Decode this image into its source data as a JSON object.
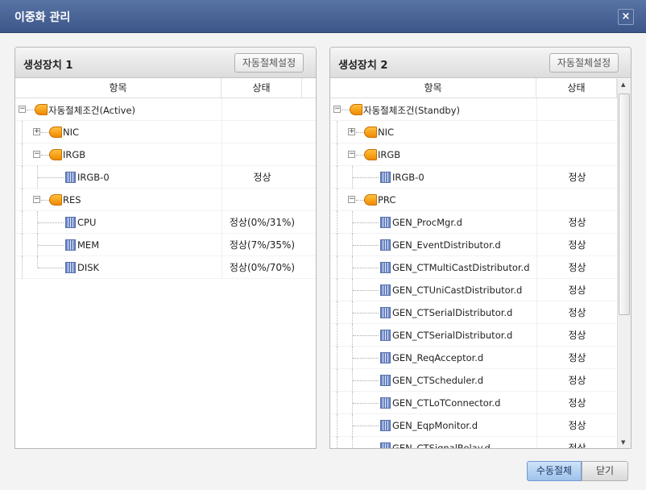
{
  "window": {
    "title": "이중화 관리",
    "close_icon": "×"
  },
  "columns": {
    "item": "항목",
    "status": "상태"
  },
  "panels": [
    {
      "title": "생성장치 1",
      "auto_button": "자동절체설정",
      "rows": [
        {
          "level": 0,
          "toggle": "minus",
          "icon": "folder",
          "label": "자동절체조건(Active)",
          "status": ""
        },
        {
          "level": 1,
          "toggle": "plus",
          "icon": "folder",
          "label": "NIC",
          "status": ""
        },
        {
          "level": 1,
          "toggle": "minus",
          "icon": "folder",
          "label": "IRGB",
          "status": ""
        },
        {
          "level": 2,
          "toggle": "",
          "icon": "doc",
          "label": "IRGB-0",
          "status": "정상"
        },
        {
          "level": 1,
          "toggle": "minus",
          "icon": "folder",
          "label": "RES",
          "status": ""
        },
        {
          "level": 2,
          "toggle": "",
          "icon": "doc",
          "label": "CPU",
          "status": "정상(0%/31%)"
        },
        {
          "level": 2,
          "toggle": "",
          "icon": "doc",
          "label": "MEM",
          "status": "정상(7%/35%)"
        },
        {
          "level": 2,
          "toggle": "",
          "icon": "doc",
          "label": "DISK",
          "status": "정상(0%/70%)"
        }
      ]
    },
    {
      "title": "생성장치 2",
      "auto_button": "자동절체설정",
      "rows": [
        {
          "level": 0,
          "toggle": "minus",
          "icon": "folder",
          "label": "자동절체조건(Standby)",
          "status": ""
        },
        {
          "level": 1,
          "toggle": "plus",
          "icon": "folder",
          "label": "NIC",
          "status": ""
        },
        {
          "level": 1,
          "toggle": "minus",
          "icon": "folder",
          "label": "IRGB",
          "status": ""
        },
        {
          "level": 2,
          "toggle": "",
          "icon": "doc",
          "label": "IRGB-0",
          "status": "정상"
        },
        {
          "level": 1,
          "toggle": "minus",
          "icon": "folder",
          "label": "PRC",
          "status": ""
        },
        {
          "level": 2,
          "toggle": "",
          "icon": "doc",
          "label": "GEN_ProcMgr.d",
          "status": "정상"
        },
        {
          "level": 2,
          "toggle": "",
          "icon": "doc",
          "label": "GEN_EventDistributor.d",
          "status": "정상"
        },
        {
          "level": 2,
          "toggle": "",
          "icon": "doc",
          "label": "GEN_CTMultiCastDistributor.d",
          "status": "정상"
        },
        {
          "level": 2,
          "toggle": "",
          "icon": "doc",
          "label": "GEN_CTUniCastDistributor.d",
          "status": "정상"
        },
        {
          "level": 2,
          "toggle": "",
          "icon": "doc",
          "label": "GEN_CTSerialDistributor.d",
          "status": "정상"
        },
        {
          "level": 2,
          "toggle": "",
          "icon": "doc",
          "label": "GEN_CTSerialDistributor.d",
          "status": "정상"
        },
        {
          "level": 2,
          "toggle": "",
          "icon": "doc",
          "label": "GEN_ReqAcceptor.d",
          "status": "정상"
        },
        {
          "level": 2,
          "toggle": "",
          "icon": "doc",
          "label": "GEN_CTScheduler.d",
          "status": "정상"
        },
        {
          "level": 2,
          "toggle": "",
          "icon": "doc",
          "label": "GEN_CTLoTConnector.d",
          "status": "정상"
        },
        {
          "level": 2,
          "toggle": "",
          "icon": "doc",
          "label": "GEN_EqpMonitor.d",
          "status": "정상"
        },
        {
          "level": 2,
          "toggle": "",
          "icon": "doc",
          "label": "GEN_CTSignalRelay.d",
          "status": "정상"
        }
      ]
    }
  ],
  "footer": {
    "manual_switch": "수동절체",
    "close": "닫기"
  }
}
